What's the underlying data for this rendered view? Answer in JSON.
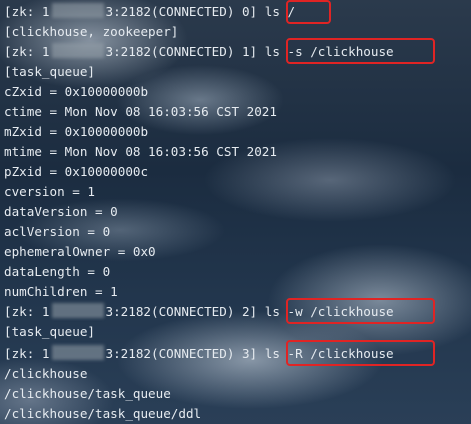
{
  "prompt_prefix": "[zk: 1",
  "lines": {
    "l0": {
      "pre": "3:2182(CONNECTED) 0] ",
      "cmd": "ls /"
    },
    "l1": {
      "text": "[clickhouse, zookeeper]"
    },
    "l2": {
      "pre": "3:2182(CONNECTED) 1] ",
      "cmd": "ls -s /clickhouse"
    },
    "l3": {
      "text": "[task_queue]"
    },
    "l4": {
      "text": "cZxid = 0x10000000b"
    },
    "l5": {
      "text": "ctime = Mon Nov 08 16:03:56 CST 2021"
    },
    "l6": {
      "text": "mZxid = 0x10000000b"
    },
    "l7": {
      "text": "mtime = Mon Nov 08 16:03:56 CST 2021"
    },
    "l8": {
      "text": "pZxid = 0x10000000c"
    },
    "l9": {
      "text": "cversion = 1"
    },
    "l10": {
      "text": "dataVersion = 0"
    },
    "l11": {
      "text": "aclVersion = 0"
    },
    "l12": {
      "text": "ephemeralOwner = 0x0"
    },
    "l13": {
      "text": "dataLength = 0"
    },
    "l14": {
      "text": "numChildren = 1"
    },
    "l15": {
      "pre": "3:2182(CONNECTED) 2] ",
      "cmd": "ls -w /clickhouse"
    },
    "l16": {
      "text": "[task_queue]"
    },
    "l17": {
      "pre": "3:2182(CONNECTED) 3] ",
      "cmd": "ls -R /clickhouse"
    },
    "l18": {
      "text": "/clickhouse"
    },
    "l19": {
      "text": "/clickhouse/task_queue"
    },
    "l20": {
      "text": "/clickhouse/task_queue/ddl"
    }
  },
  "colors": {
    "text": "#e6ebf0",
    "highlight": "#e02424"
  }
}
